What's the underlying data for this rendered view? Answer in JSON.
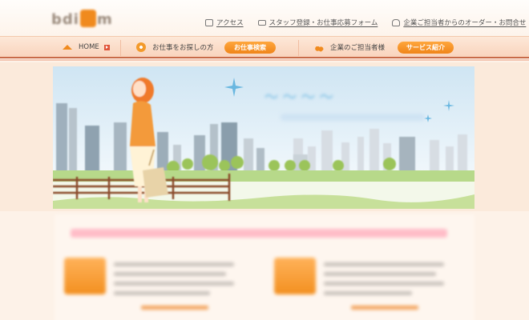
{
  "header": {
    "logo_text": "bdi m",
    "links": [
      {
        "icon": "map-icon",
        "label": "アクセス"
      },
      {
        "icon": "mail-icon",
        "label": "スタッフ登録・お仕事応募フォーム"
      },
      {
        "icon": "car-icon",
        "label": "企業ご担当者からのオーダー・お問合せ"
      }
    ]
  },
  "nav": {
    "home_label": "HOME",
    "job_seekers_label": "お仕事をお探しの方",
    "job_search_button": "お仕事検索",
    "corporate_label": "企業のご担当者様",
    "service_button": "サービス紹介"
  },
  "colors": {
    "accent": "#f0851a",
    "nav_bg": "#f9d4bd",
    "page_bg": "#fdf2e8",
    "sky": "#dcecf6",
    "grass": "#a9d36a"
  }
}
